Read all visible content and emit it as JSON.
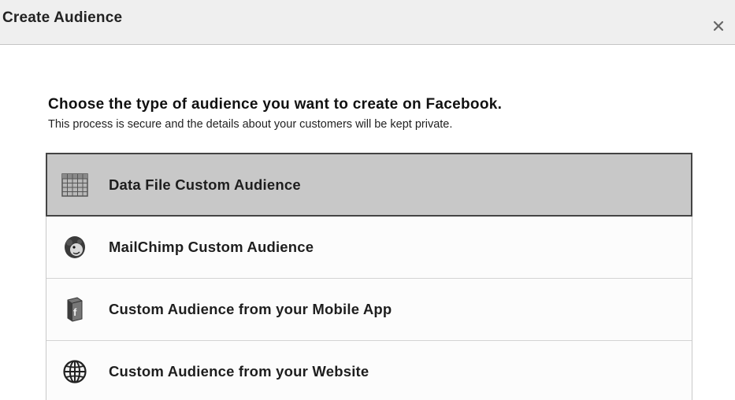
{
  "dialog": {
    "title": "Create Audience",
    "close_icon": "close-icon"
  },
  "content": {
    "heading": "Choose the type of audience you want to create on Facebook.",
    "subheading": "This process is secure and the details about your customers will be kept private."
  },
  "options": [
    {
      "label": "Data File Custom Audience",
      "icon": "spreadsheet-icon",
      "selected": true
    },
    {
      "label": "MailChimp Custom Audience",
      "icon": "mailchimp-icon",
      "selected": false
    },
    {
      "label": "Custom Audience from your Mobile App",
      "icon": "mobile-app-icon",
      "selected": false
    },
    {
      "label": "Custom Audience from your Website",
      "icon": "globe-icon",
      "selected": false
    }
  ]
}
